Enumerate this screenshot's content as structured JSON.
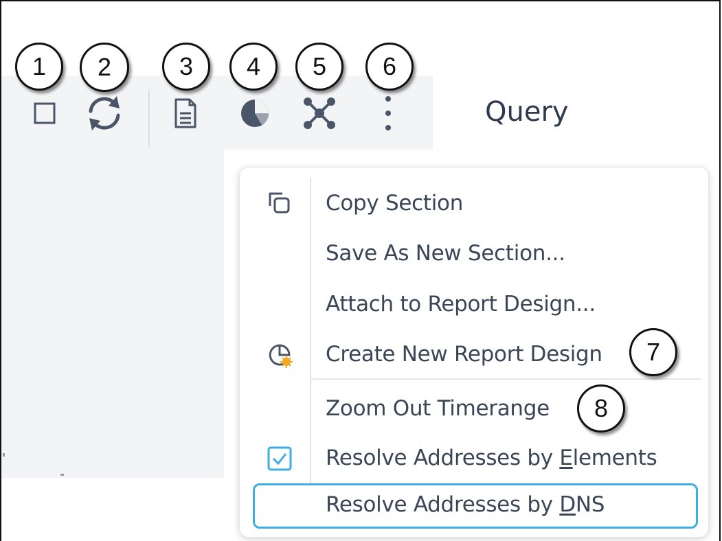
{
  "toolbar": {
    "query_label": "Query"
  },
  "callouts": [
    "1",
    "2",
    "3",
    "4",
    "5",
    "6",
    "7",
    "8"
  ],
  "menu": {
    "items": [
      {
        "label": "Copy Section",
        "icon": "copy-icon"
      },
      {
        "label": "Save As New Section..."
      },
      {
        "label": "Attach to Report Design..."
      },
      {
        "label": "Create New Report Design",
        "icon": "new-report-design-icon"
      },
      {
        "label": "Zoom Out Timerange"
      },
      {
        "label_prefix": "Resolve Addresses by ",
        "mnemonic": "E",
        "label_suffix": "lements",
        "checked": true,
        "icon": "checkbox-checked-icon"
      },
      {
        "label_prefix": "Resolve Addresses by ",
        "mnemonic": "D",
        "label_suffix": "NS",
        "highlighted": true
      }
    ]
  },
  "colors": {
    "accent": "#3daee4",
    "text": "#3a4556",
    "toolbar_bg": "#f3f4f6",
    "icon": "#4a5568"
  }
}
